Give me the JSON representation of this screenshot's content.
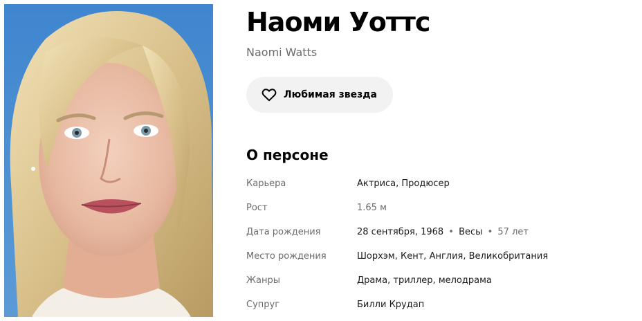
{
  "person": {
    "name_ru": "Наоми Уоттс",
    "name_original": "Naomi Watts"
  },
  "favorite_button": {
    "label": "Любимая звезда",
    "icon": "heart-outline-icon"
  },
  "about": {
    "title": "О персоне",
    "career": {
      "label": "Карьера",
      "value": "Актриса, Продюсер"
    },
    "height": {
      "label": "Рост",
      "value": "1.65 м"
    },
    "birth_date": {
      "label": "Дата рождения",
      "date": "28 сентября, 1968",
      "separator": "•",
      "zodiac": "Весы",
      "age": "57 лет"
    },
    "birth_place": {
      "label": "Место рождения",
      "value": "Шорхэм, Кент, Англия, Великобритания"
    },
    "genres": {
      "label": "Жанры",
      "value": "Драма, триллер, мелодрама"
    },
    "spouse": {
      "label": "Супруг",
      "value": "Билли Крудап"
    }
  },
  "colors": {
    "photo_background": "#4a8fd0",
    "button_background": "#f2f2f2",
    "muted_text": "#6b6b6b"
  }
}
